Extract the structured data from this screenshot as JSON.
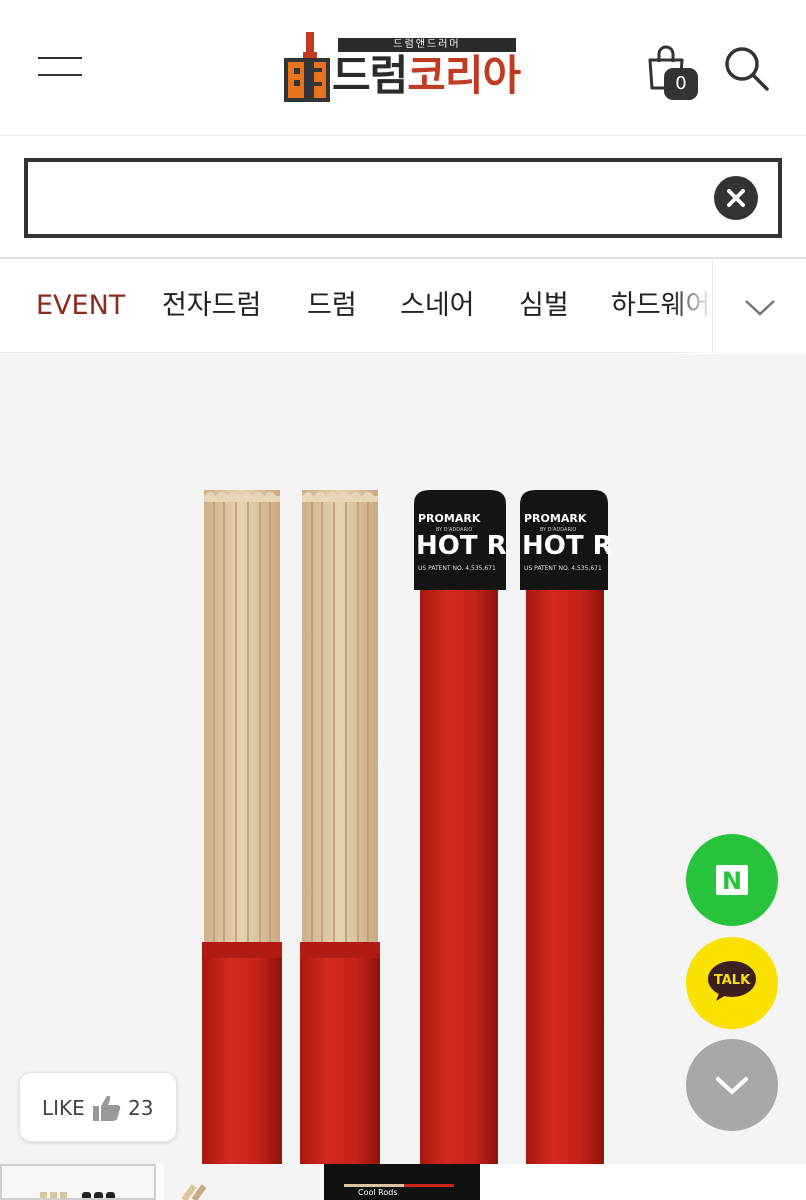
{
  "header": {
    "logo": {
      "tagline": "드럼앤드러머",
      "name_dark": "드럼",
      "name_accent": "코리아"
    },
    "cart_count": "0",
    "icons": {
      "menu": "hamburger-menu-icon",
      "cart": "shopping-bag-icon",
      "search": "magnifier-icon"
    }
  },
  "search": {
    "placeholder": "",
    "value": "",
    "clear_icon": "close-icon"
  },
  "categories": {
    "items": [
      {
        "label": "EVENT",
        "active": true
      },
      {
        "label": "전자드럼",
        "active": false
      },
      {
        "label": "드럼",
        "active": false
      },
      {
        "label": "스네어",
        "active": false
      },
      {
        "label": "심벌",
        "active": false
      },
      {
        "label": "하드웨어",
        "active": false
      }
    ],
    "expand_icon": "chevron-down-icon"
  },
  "product_image": {
    "brand_text": "PROMARK",
    "brand_sub": "BY D'ADDARIO",
    "model_text": "HOT R",
    "patent_text": "US PATENT NO. 4,535,671"
  },
  "floating": {
    "naver_label": "N",
    "talk_label": "TALK",
    "scroll_icon": "chevron-down-icon"
  },
  "like": {
    "label": "LIKE",
    "count": "23",
    "icon": "thumbs-up-icon"
  },
  "thumbnails": [
    {
      "label": ""
    },
    {
      "label": ""
    },
    {
      "label": "Cool Rods"
    }
  ],
  "colors": {
    "accent_red": "#c13a22",
    "event_red": "#8d2a1c",
    "dark": "#333333",
    "naver_green": "#27c33a",
    "kakao_yellow": "#fae100",
    "scroll_gray": "#a8a8a8",
    "rod_red": "#c8231b",
    "wood": "#dcc4a0"
  }
}
